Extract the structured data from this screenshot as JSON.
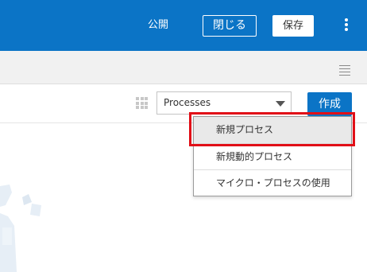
{
  "header": {
    "publish_label": "公開",
    "close_label": "閉じる",
    "save_label": "保存",
    "more_icon": "kebab-vertical-icon"
  },
  "subbar": {
    "menu_icon": "hamburger-icon"
  },
  "toolbar": {
    "grid_icon": "grid-icon",
    "select_value": "Processes",
    "create_label": "作成"
  },
  "dropdown": {
    "items": [
      {
        "label": "新規プロセス"
      },
      {
        "label": "新規動的プロセス"
      },
      {
        "label": "マイクロ・プロセスの使用"
      }
    ]
  },
  "colors": {
    "brand": "#0b74c6",
    "highlight": "#e10f17"
  }
}
